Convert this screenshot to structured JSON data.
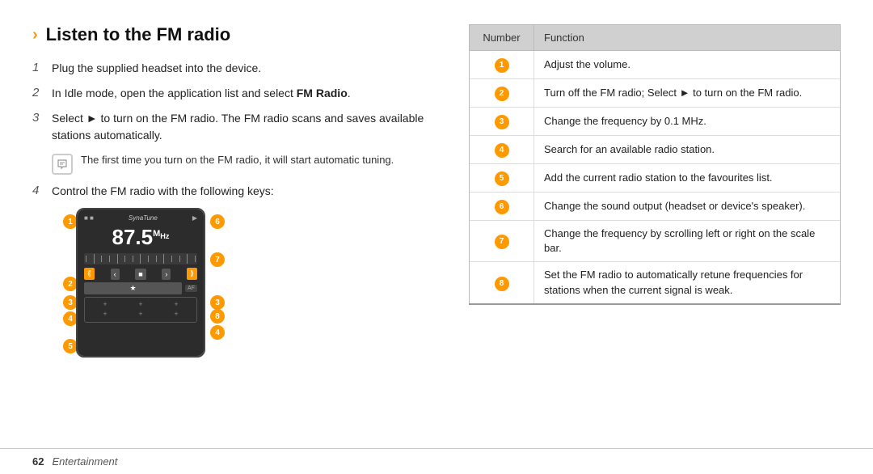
{
  "header": {
    "chevron": "›",
    "title": "Listen to the FM radio"
  },
  "steps": [
    {
      "num": "1",
      "text": "Plug the supplied headset into the device."
    },
    {
      "num": "2",
      "text": "In Idle mode, open the application list and select ",
      "bold": "FM Radio",
      "suffix": "."
    },
    {
      "num": "3",
      "text": "Select ► to turn on the FM radio. The FM radio scans and saves available stations automatically."
    },
    {
      "num": "4",
      "text": "Control the FM radio with the following keys:"
    }
  ],
  "note": {
    "text": "The first time you turn on the FM radio, it will start automatic tuning."
  },
  "device": {
    "freq": "87.5",
    "unit": "MHz",
    "brand": "SynaTune"
  },
  "table": {
    "headers": [
      "Number",
      "Function"
    ],
    "rows": [
      {
        "num": "1",
        "func": "Adjust the volume."
      },
      {
        "num": "2",
        "func": "Turn off the FM radio; Select ► to turn on the FM radio."
      },
      {
        "num": "3",
        "func": "Change the frequency by 0.1 MHz."
      },
      {
        "num": "4",
        "func": "Search for an available radio station."
      },
      {
        "num": "5",
        "func": "Add the current radio station to the favourites list."
      },
      {
        "num": "6",
        "func": "Change the sound output (headset or device's speaker)."
      },
      {
        "num": "7",
        "func": "Change the frequency by scrolling left or right on the scale bar."
      },
      {
        "num": "8",
        "func": "Set the FM radio to automatically retune frequencies for stations when the current signal is weak."
      }
    ]
  },
  "footer": {
    "page_num": "62",
    "label": "Entertainment"
  }
}
